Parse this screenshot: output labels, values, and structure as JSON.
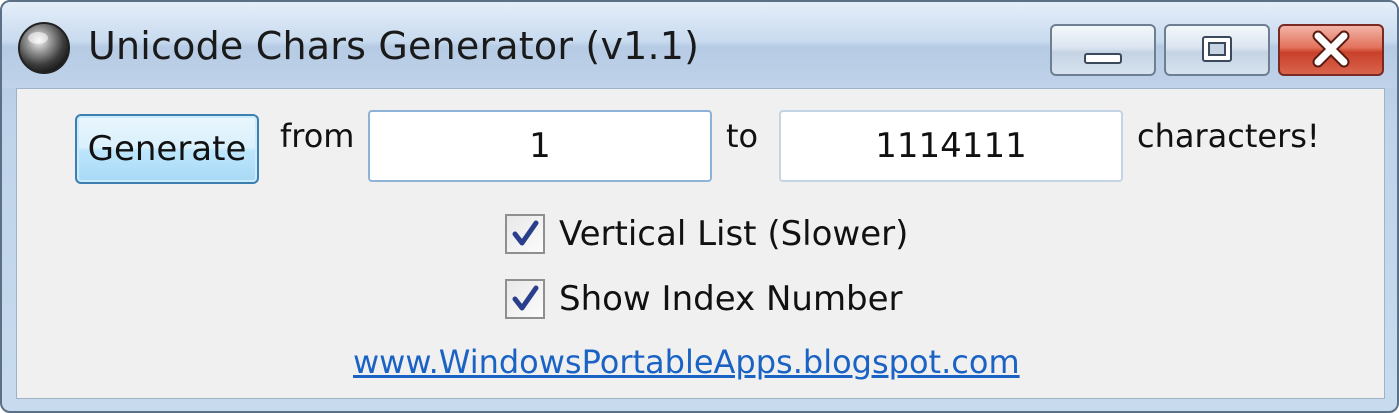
{
  "window": {
    "title": "Unicode Chars Generator (v1.1)",
    "app_icon": "gray-sphere-icon",
    "caption_buttons": [
      "minimize",
      "maximize",
      "close"
    ]
  },
  "form": {
    "generate_label": "Generate",
    "from_label": "from",
    "from_value": "1",
    "to_label": "to",
    "to_value": "1114111",
    "suffix_label": "characters!"
  },
  "options": [
    {
      "label": "Vertical List (Slower)",
      "checked": true
    },
    {
      "label": "Show Index Number",
      "checked": true
    }
  ],
  "footer": {
    "link_text": "www.WindowsPortableApps.blogspot.com"
  },
  "colors": {
    "link": "#1a63c4",
    "button_border": "#3c7fb1",
    "close_button": "#c9402a"
  }
}
